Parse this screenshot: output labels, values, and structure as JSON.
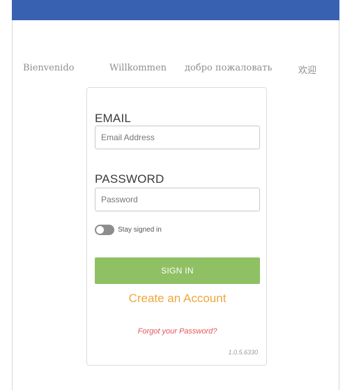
{
  "welcome_messages": [
    "Bienvenido",
    "Willkommen",
    "добро пожаловать",
    "欢迎"
  ],
  "login": {
    "email_label": "EMAIL",
    "email_placeholder": "Email Address",
    "email_value": "",
    "password_label": "PASSWORD",
    "password_placeholder": "Password",
    "password_value": "",
    "stay_signed_in_label": "Stay signed in",
    "stay_signed_in": false,
    "sign_in_label": "SIGN IN",
    "create_account_label": "Create an Account",
    "forgot_password_label": "Forgot your Password?",
    "version": "1.0.5.6330"
  },
  "colors": {
    "header": "#3862b1",
    "sign_in_button": "#8fc064",
    "create_account": "#f0a63d",
    "forgot_password": "#e5555a"
  },
  "icons": {
    "toggle": "toggle-switch-icon"
  }
}
